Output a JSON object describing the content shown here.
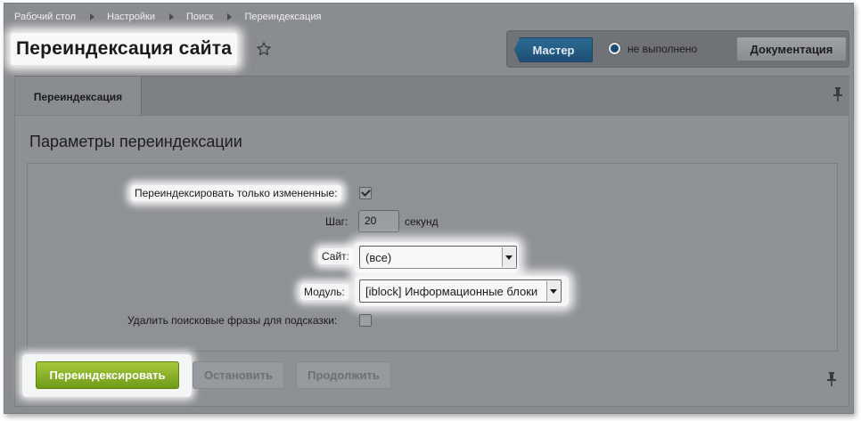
{
  "breadcrumb": [
    "Рабочий стол",
    "Настройки",
    "Поиск",
    "Переиндексация"
  ],
  "page_title": "Переиндексация сайта",
  "toolbar": {
    "master_label": "Мастер",
    "status_label": "не выполнено",
    "docs_label": "Документация"
  },
  "tabs": [
    {
      "label": "Переиндексация"
    }
  ],
  "section_title": "Параметры переиндексации",
  "form": {
    "only_changed_label": "Переиндексировать только измененные:",
    "only_changed_checked": true,
    "step_label": "Шаг:",
    "step_value": "20",
    "step_unit": "секунд",
    "site_label": "Сайт:",
    "site_value": "(все)",
    "module_label": "Модуль:",
    "module_value": "[iblock] Информационные блоки",
    "delete_phrases_label": "Удалить поисковые фразы для подсказки:",
    "delete_phrases_checked": false
  },
  "buttons": {
    "reindex": "Переиндексировать",
    "stop": "Остановить",
    "continue": "Продолжить"
  },
  "colors": {
    "primary_button": "#8bb42a",
    "master_button": "#2a6590"
  },
  "icons": {
    "favorite": "star-icon",
    "pin": "pin-icon"
  }
}
